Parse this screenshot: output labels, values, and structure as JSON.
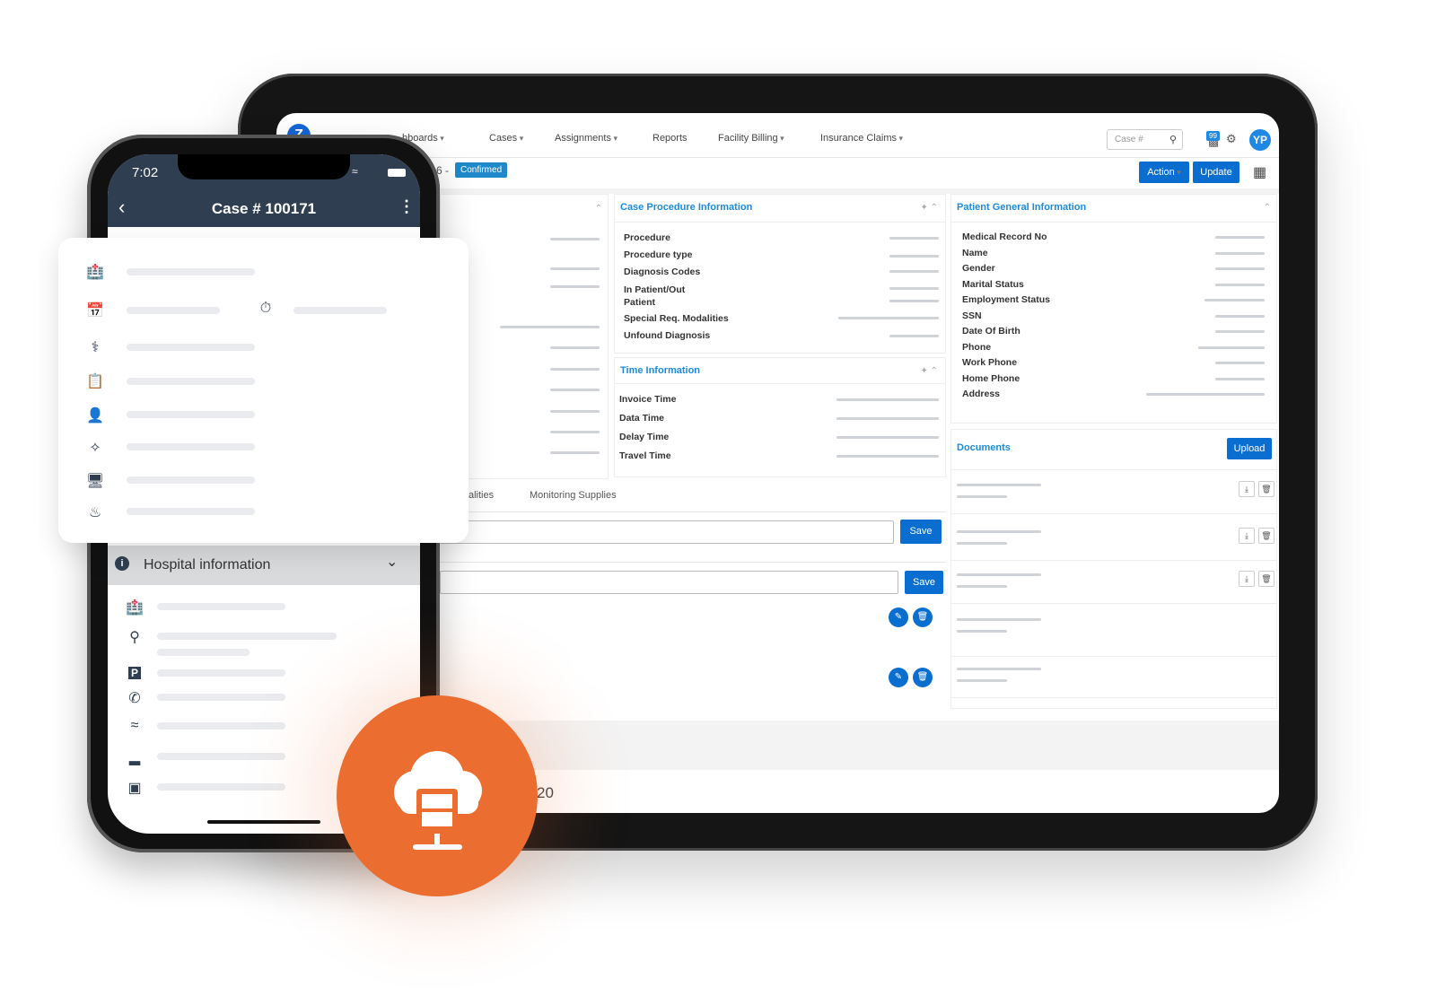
{
  "tablet": {
    "nav": {
      "items": [
        {
          "label": "hboards",
          "caret": true
        },
        {
          "label": "Cases",
          "caret": true
        },
        {
          "label": "Assignments",
          "caret": true
        },
        {
          "label": "Reports",
          "caret": false
        },
        {
          "label": "Facility Billing",
          "caret": true
        },
        {
          "label": "Insurance Claims",
          "caret": true
        }
      ],
      "search_placeholder": "Case #",
      "notifications": "99",
      "avatar": "YP"
    },
    "subheader": {
      "case_suffix": "6 -",
      "status": "Confirmed",
      "action": "Action",
      "update": "Update"
    },
    "case_procedure": {
      "title": "Case Procedure Information",
      "rows": [
        "Procedure",
        "Procedure type",
        "Diagnosis Codes",
        "In Patient/Out Patient",
        "Special Req. Modalities",
        "Unfound Diagnosis"
      ]
    },
    "time_info": {
      "title": "Time Information",
      "rows": [
        "Invoice Time",
        "Data Time",
        "Delay Time",
        "Travel Time"
      ]
    },
    "patient": {
      "title": "Patient General Information",
      "rows": [
        "Medical Record No",
        "Name",
        "Gender",
        "Marital Status",
        "Employment Status",
        "SSN",
        "Date Of Birth",
        "Phone",
        "Work Phone",
        "Home Phone",
        "Address"
      ]
    },
    "documents": {
      "title": "Documents",
      "upload": "Upload"
    },
    "tabs": [
      "alities",
      "Monitoring Supplies"
    ],
    "save": "Save",
    "footer": "20",
    "colors": {
      "primary": "#0a6ed1",
      "link": "#1a8be0",
      "accent": "#ec6d30"
    }
  },
  "phone": {
    "time": "7:02",
    "title": "Case # 100171",
    "section": "Hospital information"
  }
}
